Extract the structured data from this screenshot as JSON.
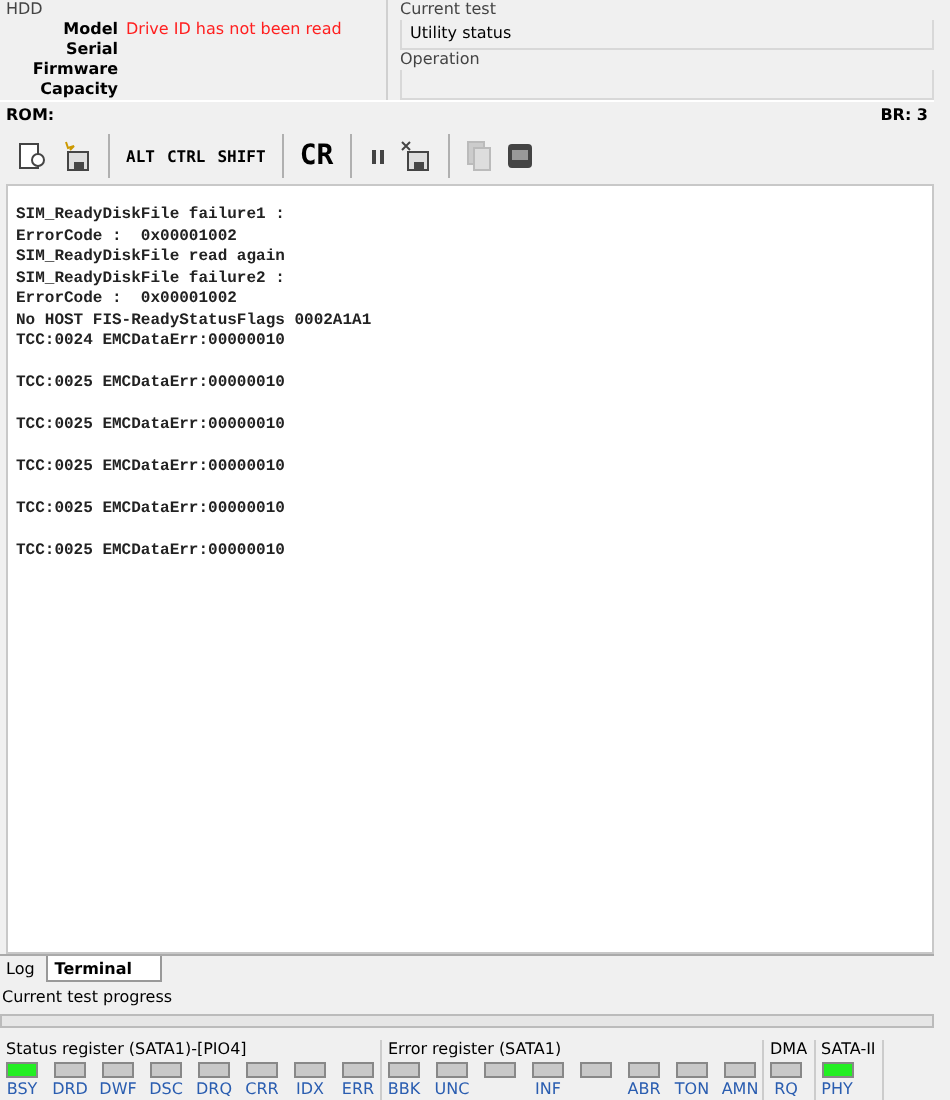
{
  "hdd": {
    "title": "HDD",
    "fields": [
      {
        "label": "Model",
        "value": "Drive ID has not been read",
        "error": true
      },
      {
        "label": "Serial"
      },
      {
        "label": "Firmware"
      },
      {
        "label": "Capacity"
      }
    ]
  },
  "current_test": {
    "title": "Current test",
    "status": "Utility status"
  },
  "operation": {
    "title": "Operation"
  },
  "rom": {
    "label": "ROM:",
    "br": "BR: 3"
  },
  "toolbar": [
    {
      "kind": "icon",
      "disabled": false
    },
    {
      "kind": "icon",
      "disabled": false
    },
    {
      "kind": "sep"
    },
    {
      "kind": "text",
      "label": "ALT"
    },
    {
      "kind": "text",
      "label": "CTRL"
    },
    {
      "kind": "text",
      "label": "SHIFT"
    },
    {
      "kind": "sep"
    },
    {
      "kind": "big",
      "label": "CR"
    },
    {
      "kind": "sep"
    },
    {
      "kind": "icon",
      "disabled": false
    },
    {
      "kind": "icon",
      "disabled": false
    },
    {
      "kind": "sep"
    },
    {
      "kind": "icon",
      "disabled": true
    },
    {
      "kind": "icon",
      "disabled": false
    }
  ],
  "terminal_text": "SIM_ReadyDiskFile failure1 :\nErrorCode :  0x00001002\nSIM_ReadyDiskFile read again\nSIM_ReadyDiskFile failure2 :\nErrorCode :  0x00001002\nNo HOST FIS-ReadyStatusFlags 0002A1A1\nTCC:0024 EMCDataErr:00000010\n\nTCC:0025 EMCDataErr:00000010\n\nTCC:0025 EMCDataErr:00000010\n\nTCC:0025 EMCDataErr:00000010\n\nTCC:0025 EMCDataErr:00000010\n\nTCC:0025 EMCDataErr:00000010",
  "tabs": [
    {
      "label": "Log",
      "selected": false
    },
    {
      "label": "Terminal",
      "selected": true
    }
  ],
  "progress": {
    "label": "Current test progress",
    "level": 0
  },
  "registers": [
    {
      "title": "Status register (SATA1)-[PIO4]",
      "leds": [
        {
          "label": "BSY",
          "on": true
        },
        {
          "label": "DRD",
          "on": false
        },
        {
          "label": "DWF",
          "on": false
        },
        {
          "label": "DSC",
          "on": false
        },
        {
          "label": "DRQ",
          "on": false
        },
        {
          "label": "CRR",
          "on": false
        },
        {
          "label": "IDX",
          "on": false
        },
        {
          "label": "ERR",
          "on": false
        }
      ]
    },
    {
      "title": "Error register (SATA1)",
      "leds": [
        {
          "label": "BBK",
          "on": false
        },
        {
          "label": "UNC",
          "on": false
        },
        {
          "on": false
        },
        {
          "label": "INF",
          "on": false
        },
        {
          "on": false
        },
        {
          "label": "ABR",
          "on": false
        },
        {
          "label": "TON",
          "on": false
        },
        {
          "label": "AMN",
          "on": false
        }
      ]
    },
    {
      "title": "DMA",
      "leds": [
        {
          "label": "RQ",
          "on": false
        }
      ]
    },
    {
      "title": "SATA-II",
      "leds": [
        {
          "label": "PHY",
          "on": true
        }
      ]
    }
  ]
}
